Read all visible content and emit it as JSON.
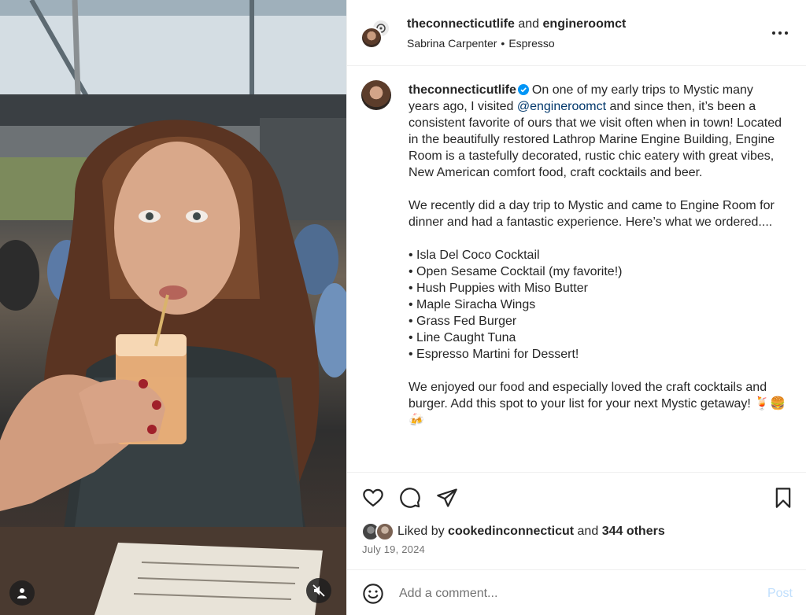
{
  "header": {
    "account_primary": "theconnecticutlife",
    "joiner": "and",
    "account_secondary": "engineroomct",
    "audio_artist": "Sabrina Carpenter",
    "audio_separator": "•",
    "audio_track": "Espresso"
  },
  "caption": {
    "username": "theconnecticutlife",
    "verified": true,
    "intro_before_mention": "On one of my early trips to Mystic many years ago, I visited",
    "mention": "@engineroomct",
    "intro_after_mention": "and since then, it’s been a consistent favorite of ours that we visit often when in town! Located in the beautifully restored Lathrop Marine Engine Building, Engine Room is a tastefully decorated, rustic chic eatery with great vibes, New American comfort food, craft cocktails and beer.",
    "paragraph_2": "We recently did a day trip to Mystic and came to Engine Room for dinner and had a fantastic experience. Here’s what we ordered....",
    "items": [
      "• Isla Del Coco Cocktail",
      "• Open Sesame Cocktail (my favorite!)",
      "• Hush Puppies with Miso Butter",
      "• Maple Siracha Wings",
      "• Grass Fed Burger",
      "• Line Caught Tuna",
      "• Espresso Martini for Dessert!"
    ],
    "closing": "We enjoyed our food and especially loved the craft cocktails and burger. Add this spot to your list for your next Mystic getaway! 🍹🍔🍻"
  },
  "actions": {
    "icons": [
      "heart-icon",
      "comment-icon",
      "share-icon",
      "bookmark-icon"
    ]
  },
  "likes": {
    "prefix": "Liked by",
    "liked_by_user": "cookedinconnecticut",
    "joiner": "and",
    "others": "344 others"
  },
  "post_date": "July 19, 2024",
  "comment": {
    "placeholder": "Add a comment...",
    "value": "",
    "post_label": "Post"
  },
  "media": {
    "icons": [
      "user-tag-icon",
      "mute-icon"
    ]
  },
  "colors": {
    "text": "#262626",
    "secondary_text": "#737373",
    "mention": "#00376b",
    "verified_badge": "#0095f6",
    "post_button_disabled": "#c0dffd",
    "divider": "#efefef"
  }
}
